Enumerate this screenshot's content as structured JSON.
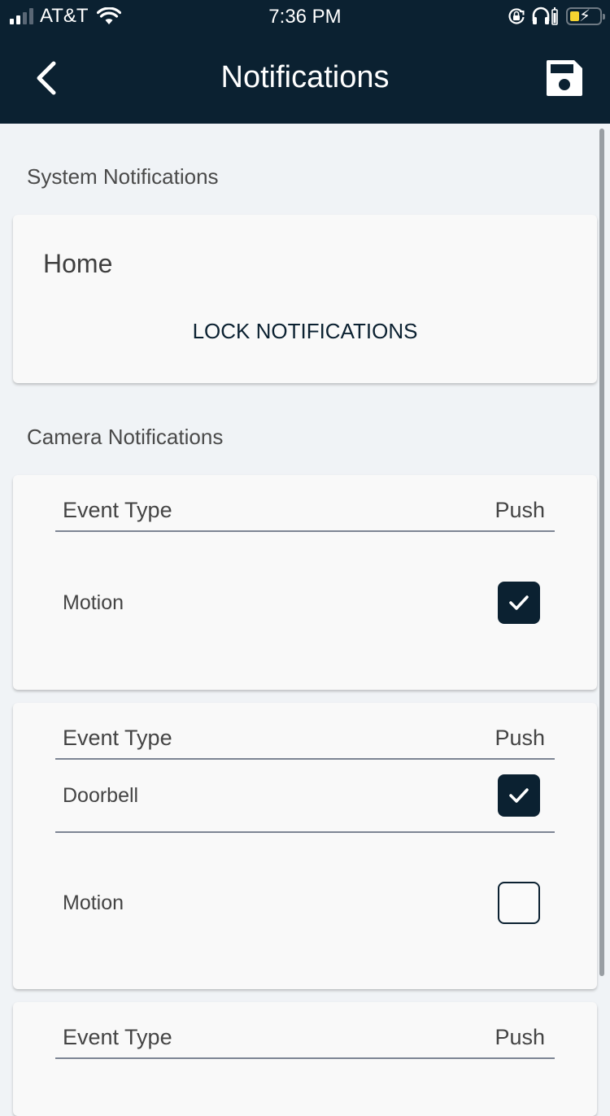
{
  "status_bar": {
    "carrier": "AT&T",
    "time": "7:36 PM",
    "signal_bars_active": 2,
    "signal_bars_total": 4,
    "icons": [
      "signal-icon",
      "wifi-icon",
      "orientation-lock-icon",
      "headphones-icon",
      "battery-charging-icon"
    ]
  },
  "nav": {
    "title": "Notifications",
    "back_icon": "chevron-left-icon",
    "save_icon": "floppy-disk-icon"
  },
  "system_section": {
    "label": "System Notifications",
    "card": {
      "title": "Home",
      "button_label": "LOCK NOTIFICATIONS"
    }
  },
  "camera_section": {
    "label": "Camera Notifications",
    "cards": [
      {
        "header": {
          "event_type": "Event Type",
          "push": "Push"
        },
        "rows": [
          {
            "label": "Motion",
            "push": true
          }
        ]
      },
      {
        "header": {
          "event_type": "Event Type",
          "push": "Push"
        },
        "rows": [
          {
            "label": "Doorbell",
            "push": true
          },
          {
            "label": "Motion",
            "push": false
          }
        ]
      },
      {
        "header": {
          "event_type": "Event Type",
          "push": "Push"
        },
        "rows": []
      }
    ]
  },
  "colors": {
    "header_bg": "#0b2131",
    "page_bg": "#f0f3f6",
    "card_bg": "#f9f9f9",
    "checkbox_on": "#0b2131",
    "battery_fill": "#f5d431",
    "divider": "#7d8594"
  }
}
